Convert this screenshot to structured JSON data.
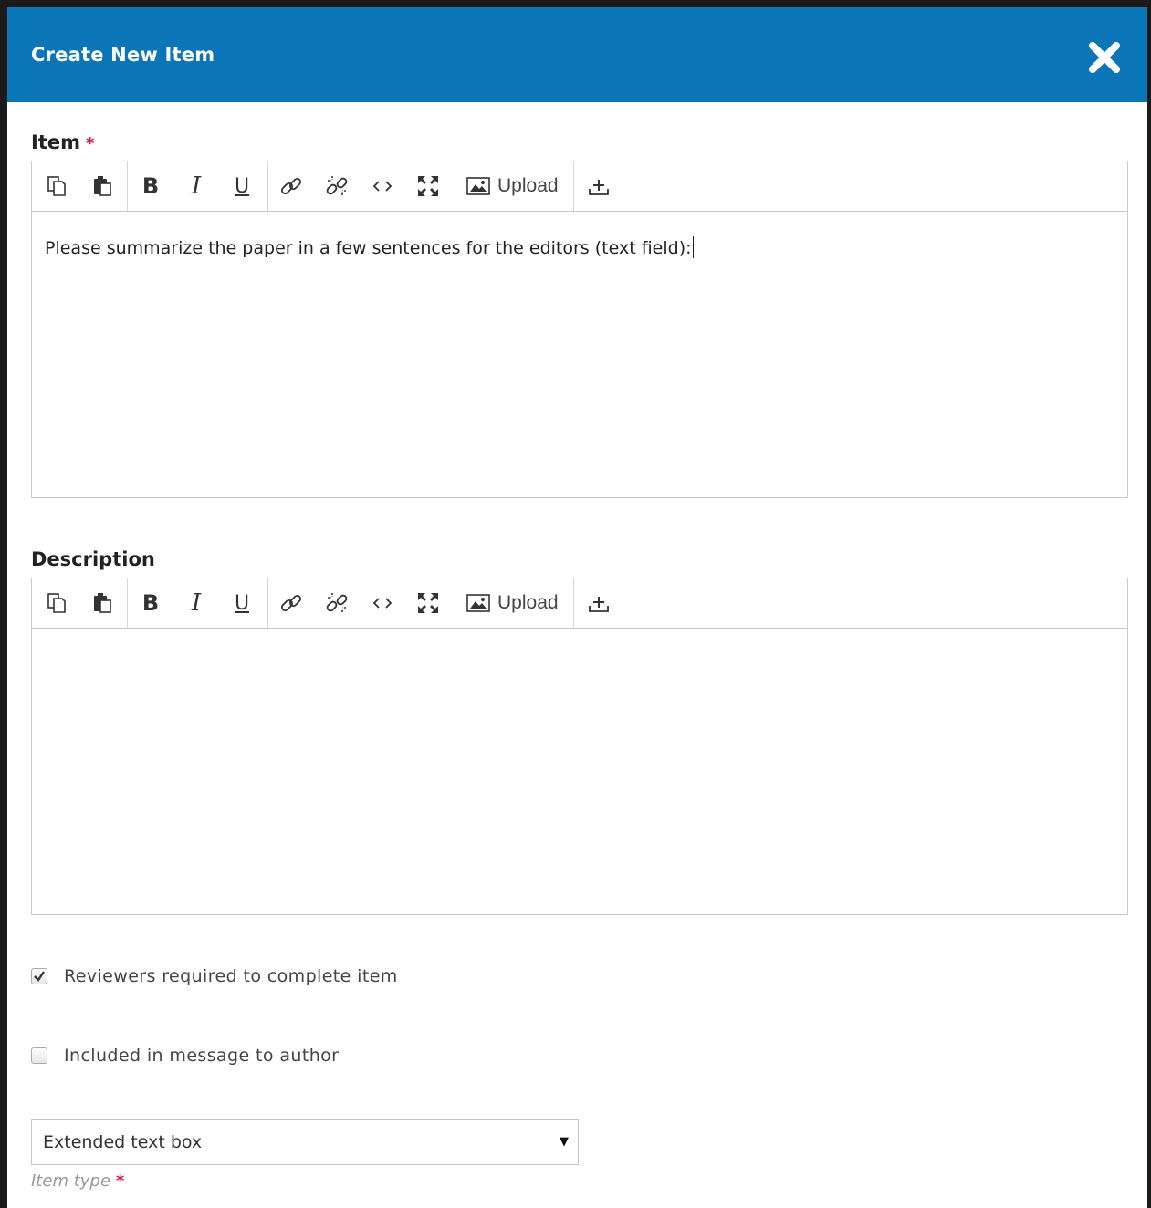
{
  "dialog": {
    "title": "Create New Item",
    "close_icon": "close-icon"
  },
  "item_field": {
    "label": "Item",
    "required_mark": "*",
    "content": "Please summarize the paper in a few sentences for the editors (text field):"
  },
  "description_field": {
    "label": "Description",
    "content": ""
  },
  "toolbar": {
    "bold": "B",
    "italic": "I",
    "underline": "U",
    "upload_label": "Upload",
    "icons": [
      "copy-icon",
      "paste-icon",
      "bold-icon",
      "italic-icon",
      "underline-icon",
      "link-icon",
      "unlink-icon",
      "code-icon",
      "fullscreen-icon",
      "image-icon",
      "insert-icon"
    ]
  },
  "options": {
    "reviewers_required": {
      "label": "Reviewers required to complete item",
      "checked": true
    },
    "included_in_message": {
      "label": "Included in message to author",
      "checked": false
    }
  },
  "item_type": {
    "selected": "Extended text box",
    "help_label": "Item type",
    "required_mark": "*"
  },
  "colors": {
    "header_bg": "#0a76b7",
    "required": "#d0145c"
  }
}
